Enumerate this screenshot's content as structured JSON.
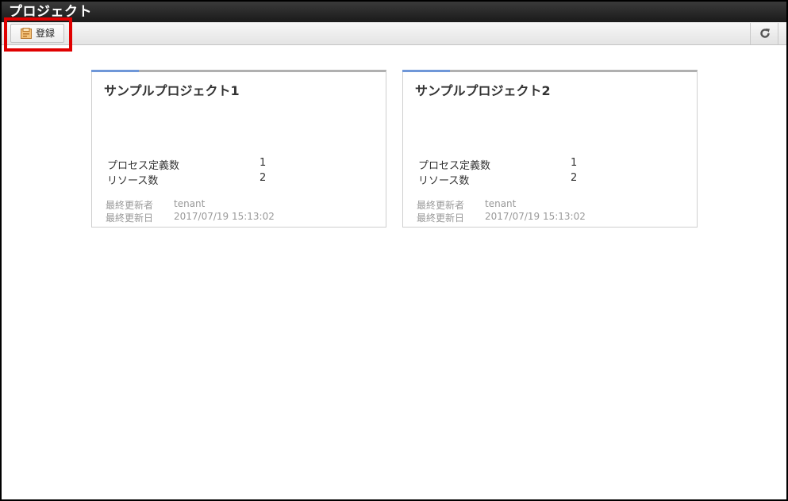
{
  "window": {
    "title": "プロジェクト"
  },
  "toolbar": {
    "register_label": "登録",
    "register_icon": "register-icon",
    "refresh_icon": "refresh-icon"
  },
  "projects": [
    {
      "name": "サンプルプロジェクト1",
      "process_label": "プロセス定義数",
      "process_count": "1",
      "resource_label": "リソース数",
      "resource_count": "2",
      "updater_label": "最終更新者",
      "updater": "tenant",
      "updated_label": "最終更新日",
      "updated": "2017/07/19 15:13:02"
    },
    {
      "name": "サンプルプロジェクト2",
      "process_label": "プロセス定義数",
      "process_count": "1",
      "resource_label": "リソース数",
      "resource_count": "2",
      "updater_label": "最終更新者",
      "updater": "tenant",
      "updated_label": "最終更新日",
      "updated": "2017/07/19 15:13:02"
    }
  ],
  "colors": {
    "accent": "#6f97d8",
    "highlight": "#e00000",
    "titlebar": "#1f1f1f"
  }
}
